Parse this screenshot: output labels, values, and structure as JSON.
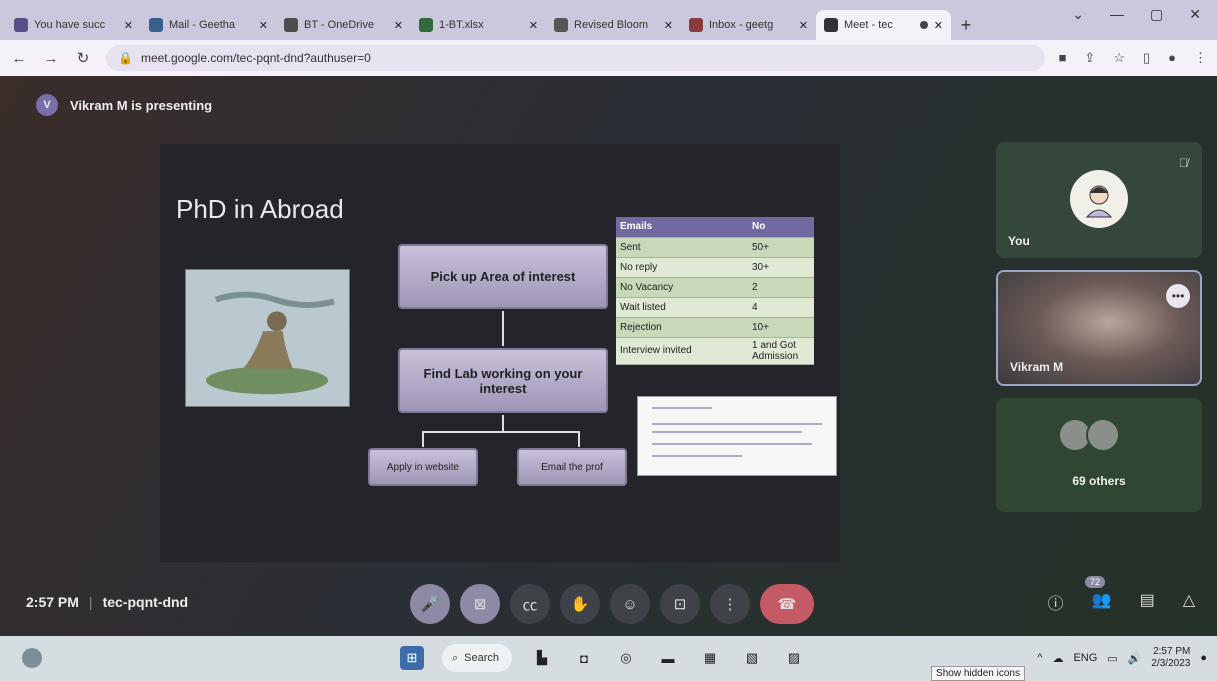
{
  "browser": {
    "tabs": [
      {
        "title": "You have succ",
        "favicon_color": "#5b4c8a"
      },
      {
        "title": "Mail - Geetha",
        "favicon_color": "#3a5f8a"
      },
      {
        "title": "BT - OneDrive",
        "favicon_color": "#4d4d4d"
      },
      {
        "title": "1-BT.xlsx",
        "favicon_color": "#2f6b3a"
      },
      {
        "title": "Revised Bloom",
        "favicon_color": "#555555"
      },
      {
        "title": "Inbox - geetg",
        "favicon_color": "#8a3b3b"
      },
      {
        "title": "Meet - tec",
        "favicon_color": "#333333",
        "active": true
      }
    ],
    "new_tab_label": "+",
    "url": "meet.google.com/tec-pqnt-dnd?authuser=0"
  },
  "meet": {
    "presenter_initial": "V",
    "presenting_text": "Vikram M is presenting",
    "meeting_time": "2:57 PM",
    "meeting_code": "tec-pqnt-dnd",
    "participant_count": "72",
    "tiles": {
      "you_label": "You",
      "presenter_label": "Vikram M",
      "others_label": "69 others"
    }
  },
  "slide": {
    "title": "PhD in Abroad",
    "flow": {
      "step1": "Pick up Area of interest",
      "step2": "Find Lab working on your interest",
      "option1": "Apply in website",
      "option2": "Email the prof"
    },
    "table": {
      "headers": [
        "Emails",
        "No"
      ],
      "rows": [
        [
          "Sent",
          "50+"
        ],
        [
          "No reply",
          "30+"
        ],
        [
          "No Vacancy",
          "2"
        ],
        [
          "Wait listed",
          "4"
        ],
        [
          "Rejection",
          "10+"
        ],
        [
          "Interview invited",
          "1 and Got Admission"
        ]
      ]
    }
  },
  "taskbar": {
    "search_label": "Search",
    "language": "ENG",
    "clock_time": "2:57 PM",
    "clock_date": "2/3/2023",
    "tooltip": "Show hidden icons"
  }
}
